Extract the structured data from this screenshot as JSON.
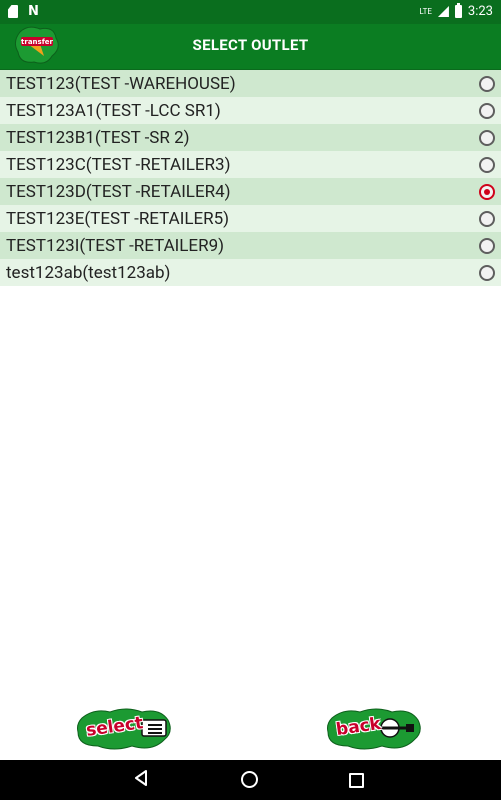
{
  "status_bar": {
    "time": "3:23",
    "network": "LTE",
    "icons": [
      "sd-card-icon",
      "n-notification-icon",
      "signal-icon",
      "battery-icon"
    ]
  },
  "app_bar": {
    "title": "SELECT OUTLET",
    "logo_text": "transfer"
  },
  "outlets": [
    {
      "label": "TEST123(TEST -WAREHOUSE)",
      "selected": false
    },
    {
      "label": "TEST123A1(TEST -LCC SR1)",
      "selected": false
    },
    {
      "label": "TEST123B1(TEST -SR 2)",
      "selected": false
    },
    {
      "label": "TEST123C(TEST -RETAILER3)",
      "selected": false
    },
    {
      "label": "TEST123D(TEST -RETAILER4)",
      "selected": true
    },
    {
      "label": "TEST123E(TEST -RETAILER5)",
      "selected": false
    },
    {
      "label": "TEST123I(TEST -RETAILER9)",
      "selected": false
    },
    {
      "label": "test123ab(test123ab)",
      "selected": false
    }
  ],
  "buttons": {
    "select_label": "select",
    "back_label": "back"
  },
  "colors": {
    "app_bar": "#0b7d22",
    "status_bar": "#0a6e1e",
    "row_odd": "#cfe8cf",
    "row_even": "#e6f4e6",
    "radio_selected": "#d0021b"
  }
}
